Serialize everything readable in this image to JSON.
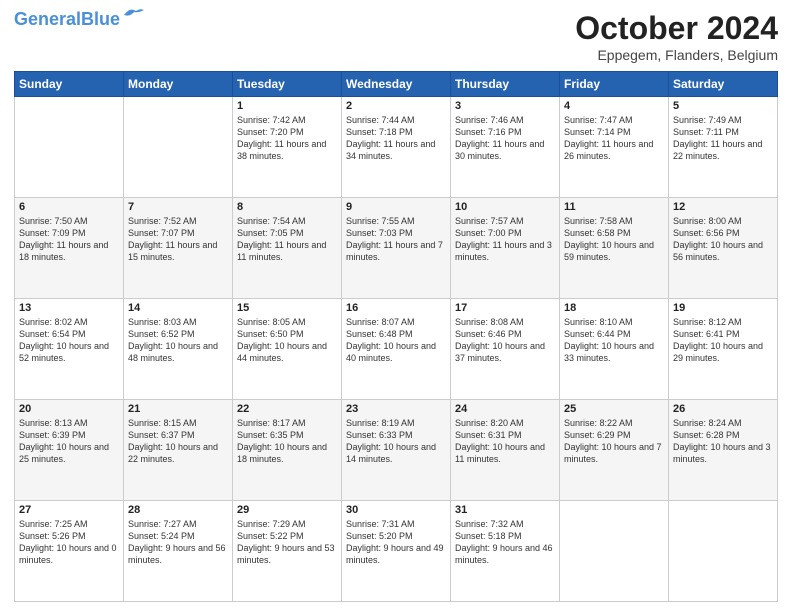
{
  "header": {
    "logo_line1": "General",
    "logo_line2": "Blue",
    "month": "October 2024",
    "location": "Eppegem, Flanders, Belgium"
  },
  "weekdays": [
    "Sunday",
    "Monday",
    "Tuesday",
    "Wednesday",
    "Thursday",
    "Friday",
    "Saturday"
  ],
  "weeks": [
    [
      {
        "day": "",
        "info": ""
      },
      {
        "day": "",
        "info": ""
      },
      {
        "day": "1",
        "info": "Sunrise: 7:42 AM\nSunset: 7:20 PM\nDaylight: 11 hours and 38 minutes."
      },
      {
        "day": "2",
        "info": "Sunrise: 7:44 AM\nSunset: 7:18 PM\nDaylight: 11 hours and 34 minutes."
      },
      {
        "day": "3",
        "info": "Sunrise: 7:46 AM\nSunset: 7:16 PM\nDaylight: 11 hours and 30 minutes."
      },
      {
        "day": "4",
        "info": "Sunrise: 7:47 AM\nSunset: 7:14 PM\nDaylight: 11 hours and 26 minutes."
      },
      {
        "day": "5",
        "info": "Sunrise: 7:49 AM\nSunset: 7:11 PM\nDaylight: 11 hours and 22 minutes."
      }
    ],
    [
      {
        "day": "6",
        "info": "Sunrise: 7:50 AM\nSunset: 7:09 PM\nDaylight: 11 hours and 18 minutes."
      },
      {
        "day": "7",
        "info": "Sunrise: 7:52 AM\nSunset: 7:07 PM\nDaylight: 11 hours and 15 minutes."
      },
      {
        "day": "8",
        "info": "Sunrise: 7:54 AM\nSunset: 7:05 PM\nDaylight: 11 hours and 11 minutes."
      },
      {
        "day": "9",
        "info": "Sunrise: 7:55 AM\nSunset: 7:03 PM\nDaylight: 11 hours and 7 minutes."
      },
      {
        "day": "10",
        "info": "Sunrise: 7:57 AM\nSunset: 7:00 PM\nDaylight: 11 hours and 3 minutes."
      },
      {
        "day": "11",
        "info": "Sunrise: 7:58 AM\nSunset: 6:58 PM\nDaylight: 10 hours and 59 minutes."
      },
      {
        "day": "12",
        "info": "Sunrise: 8:00 AM\nSunset: 6:56 PM\nDaylight: 10 hours and 56 minutes."
      }
    ],
    [
      {
        "day": "13",
        "info": "Sunrise: 8:02 AM\nSunset: 6:54 PM\nDaylight: 10 hours and 52 minutes."
      },
      {
        "day": "14",
        "info": "Sunrise: 8:03 AM\nSunset: 6:52 PM\nDaylight: 10 hours and 48 minutes."
      },
      {
        "day": "15",
        "info": "Sunrise: 8:05 AM\nSunset: 6:50 PM\nDaylight: 10 hours and 44 minutes."
      },
      {
        "day": "16",
        "info": "Sunrise: 8:07 AM\nSunset: 6:48 PM\nDaylight: 10 hours and 40 minutes."
      },
      {
        "day": "17",
        "info": "Sunrise: 8:08 AM\nSunset: 6:46 PM\nDaylight: 10 hours and 37 minutes."
      },
      {
        "day": "18",
        "info": "Sunrise: 8:10 AM\nSunset: 6:44 PM\nDaylight: 10 hours and 33 minutes."
      },
      {
        "day": "19",
        "info": "Sunrise: 8:12 AM\nSunset: 6:41 PM\nDaylight: 10 hours and 29 minutes."
      }
    ],
    [
      {
        "day": "20",
        "info": "Sunrise: 8:13 AM\nSunset: 6:39 PM\nDaylight: 10 hours and 25 minutes."
      },
      {
        "day": "21",
        "info": "Sunrise: 8:15 AM\nSunset: 6:37 PM\nDaylight: 10 hours and 22 minutes."
      },
      {
        "day": "22",
        "info": "Sunrise: 8:17 AM\nSunset: 6:35 PM\nDaylight: 10 hours and 18 minutes."
      },
      {
        "day": "23",
        "info": "Sunrise: 8:19 AM\nSunset: 6:33 PM\nDaylight: 10 hours and 14 minutes."
      },
      {
        "day": "24",
        "info": "Sunrise: 8:20 AM\nSunset: 6:31 PM\nDaylight: 10 hours and 11 minutes."
      },
      {
        "day": "25",
        "info": "Sunrise: 8:22 AM\nSunset: 6:29 PM\nDaylight: 10 hours and 7 minutes."
      },
      {
        "day": "26",
        "info": "Sunrise: 8:24 AM\nSunset: 6:28 PM\nDaylight: 10 hours and 3 minutes."
      }
    ],
    [
      {
        "day": "27",
        "info": "Sunrise: 7:25 AM\nSunset: 5:26 PM\nDaylight: 10 hours and 0 minutes."
      },
      {
        "day": "28",
        "info": "Sunrise: 7:27 AM\nSunset: 5:24 PM\nDaylight: 9 hours and 56 minutes."
      },
      {
        "day": "29",
        "info": "Sunrise: 7:29 AM\nSunset: 5:22 PM\nDaylight: 9 hours and 53 minutes."
      },
      {
        "day": "30",
        "info": "Sunrise: 7:31 AM\nSunset: 5:20 PM\nDaylight: 9 hours and 49 minutes."
      },
      {
        "day": "31",
        "info": "Sunrise: 7:32 AM\nSunset: 5:18 PM\nDaylight: 9 hours and 46 minutes."
      },
      {
        "day": "",
        "info": ""
      },
      {
        "day": "",
        "info": ""
      }
    ]
  ]
}
